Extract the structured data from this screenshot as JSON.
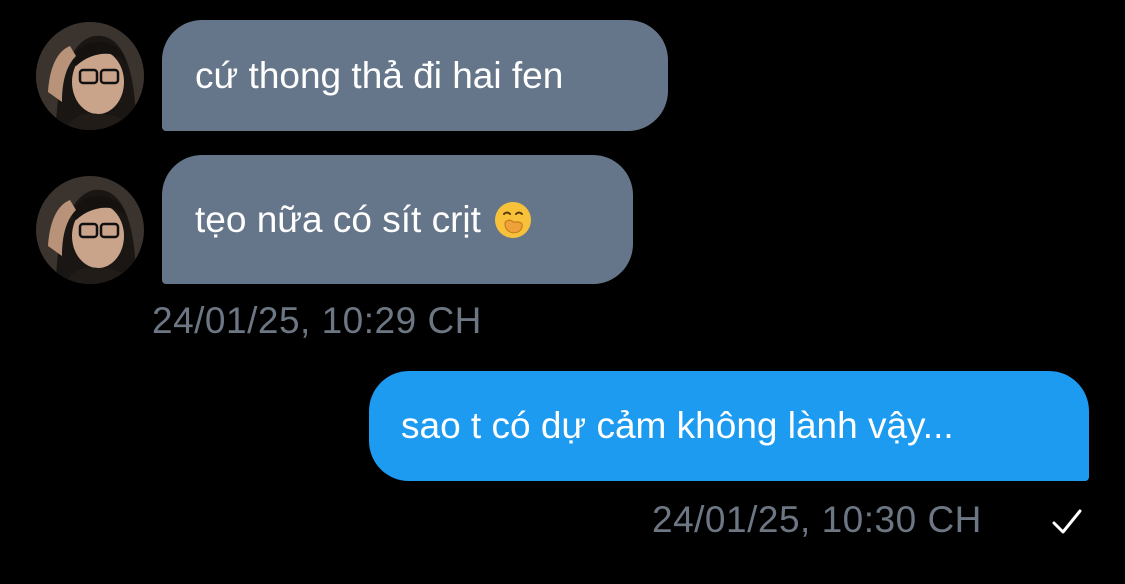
{
  "colors": {
    "background": "#000000",
    "incoming_bubble": "#66768a",
    "outgoing_bubble": "#1d9bf0",
    "timestamp_text": "#6d7784",
    "message_text": "#ffffff"
  },
  "messages": [
    {
      "direction": "incoming",
      "text": "cứ thong thả đi hai fen"
    },
    {
      "direction": "incoming",
      "text": "tẹo nữa có sít crịt",
      "emoji": "face-with-hand-over-mouth-emoji"
    }
  ],
  "incoming_timestamp": "24/01/25, 10:29 CH",
  "outgoing": {
    "text": "sao t có dự cảm không lành vậy...",
    "timestamp": "24/01/25, 10:30 CH",
    "status_icon": "checkmark-icon"
  }
}
